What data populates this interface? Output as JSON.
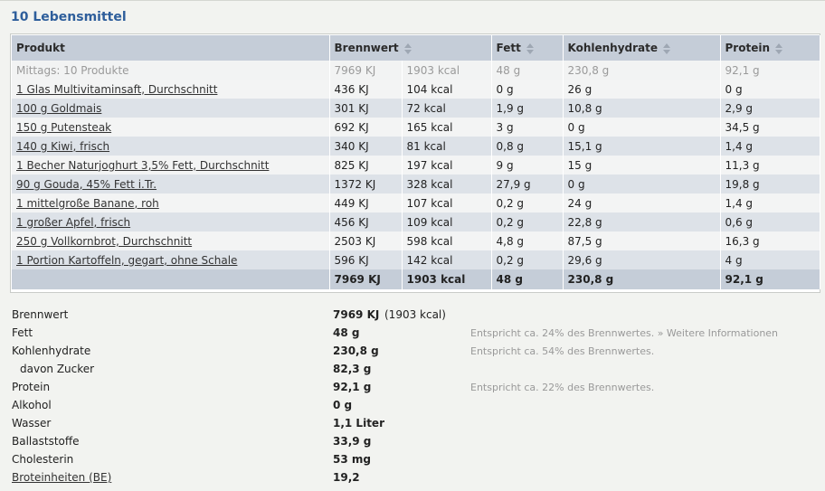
{
  "title": "10 Lebensmittel",
  "columns": {
    "product": "Produkt",
    "energy": "Brennwert",
    "fat": "Fett",
    "carbs": "Kohlenhydrate",
    "protein": "Protein"
  },
  "meal_row": {
    "label": "Mittags: 10 Produkte",
    "kj": "7969 KJ",
    "kcal": "1903 kcal",
    "fat": "48 g",
    "carbs": "230,8 g",
    "protein": "92,1 g"
  },
  "rows": [
    {
      "name": "1 Glas Multivitaminsaft, Durchschnitt",
      "kj": "436 KJ",
      "kcal": "104 kcal",
      "fat": "0 g",
      "carbs": "26 g",
      "protein": "0 g"
    },
    {
      "name": "100 g Goldmais",
      "kj": "301 KJ",
      "kcal": "72 kcal",
      "fat": "1,9 g",
      "carbs": "10,8 g",
      "protein": "2,9 g"
    },
    {
      "name": "150 g Putensteak",
      "kj": "692 KJ",
      "kcal": "165 kcal",
      "fat": "3 g",
      "carbs": "0 g",
      "protein": "34,5 g"
    },
    {
      "name": "140 g Kiwi, frisch",
      "kj": "340 KJ",
      "kcal": "81 kcal",
      "fat": "0,8 g",
      "carbs": "15,1 g",
      "protein": "1,4 g"
    },
    {
      "name": "1 Becher Naturjoghurt 3,5% Fett, Durchschnitt",
      "kj": "825 KJ",
      "kcal": "197 kcal",
      "fat": "9 g",
      "carbs": "15 g",
      "protein": "11,3 g"
    },
    {
      "name": "90 g Gouda, 45% Fett i.Tr.",
      "kj": "1372 KJ",
      "kcal": "328 kcal",
      "fat": "27,9 g",
      "carbs": "0 g",
      "protein": "19,8 g"
    },
    {
      "name": "1 mittelgroße Banane, roh",
      "kj": "449 KJ",
      "kcal": "107 kcal",
      "fat": "0,2 g",
      "carbs": "24 g",
      "protein": "1,4 g"
    },
    {
      "name": "1 großer Apfel, frisch",
      "kj": "456 KJ",
      "kcal": "109 kcal",
      "fat": "0,2 g",
      "carbs": "22,8 g",
      "protein": "0,6 g"
    },
    {
      "name": "250 g Vollkornbrot, Durchschnitt",
      "kj": "2503 KJ",
      "kcal": "598 kcal",
      "fat": "4,8 g",
      "carbs": "87,5 g",
      "protein": "16,3 g"
    },
    {
      "name": "1 Portion Kartoffeln, gegart, ohne Schale",
      "kj": "596 KJ",
      "kcal": "142 kcal",
      "fat": "0,2 g",
      "carbs": "29,6 g",
      "protein": "4 g"
    }
  ],
  "total_row": {
    "kj": "7969 KJ",
    "kcal": "1903 kcal",
    "fat": "48 g",
    "carbs": "230,8 g",
    "protein": "92,1 g"
  },
  "summary": {
    "energy": {
      "label": "Brennwert",
      "value": "7969 KJ",
      "extra": "(1903 kcal)"
    },
    "fat": {
      "label": "Fett",
      "value": "48 g",
      "note": "Entspricht ca. 24% des Brennwertes.",
      "link": "» Weitere Informationen"
    },
    "carbs": {
      "label": "Kohlenhydrate",
      "value": "230,8 g",
      "note": "Entspricht ca. 54% des Brennwertes."
    },
    "sugar": {
      "label": "davon Zucker",
      "value": "82,3 g"
    },
    "protein": {
      "label": "Protein",
      "value": "92,1 g",
      "note": "Entspricht ca. 22% des Brennwertes."
    },
    "alcohol": {
      "label": "Alkohol",
      "value": "0 g"
    },
    "water": {
      "label": "Wasser",
      "value": "1,1 Liter"
    },
    "fiber": {
      "label": "Ballaststoffe",
      "value": "33,9 g"
    },
    "cholesterol": {
      "label": "Cholesterin",
      "value": "53 mg"
    },
    "be": {
      "label": "Broteinheiten (BE)",
      "value": "19,2"
    }
  }
}
